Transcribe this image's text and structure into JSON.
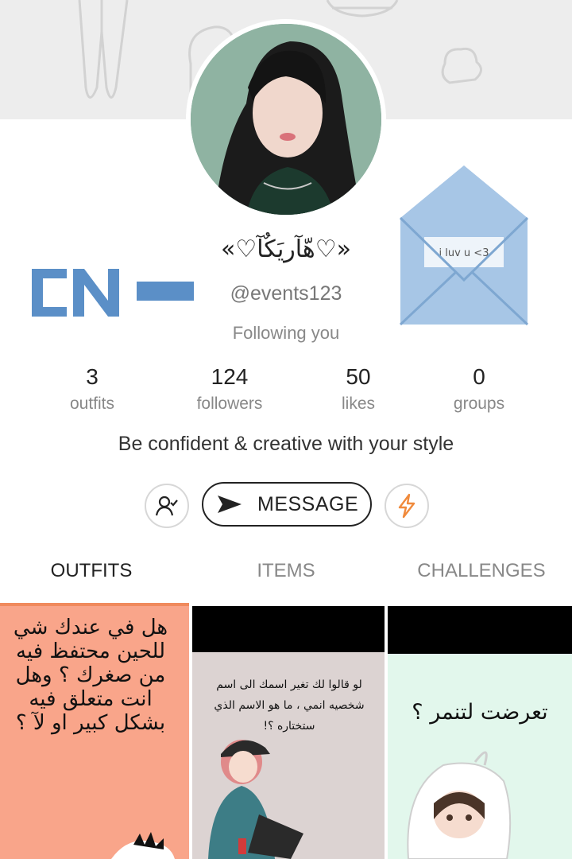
{
  "profile": {
    "display_name": "«♡هّآريَكٌآ♡»",
    "handle": "@events123",
    "follow_status": "Following you",
    "bio": "Be confident & creative with your style"
  },
  "stats": [
    {
      "value": "3",
      "label": "outfits"
    },
    {
      "value": "124",
      "label": "followers"
    },
    {
      "value": "50",
      "label": "likes"
    },
    {
      "value": "0",
      "label": "groups"
    }
  ],
  "actions": {
    "message_label": "MESSAGE",
    "follow_icon": "user-check-icon",
    "boost_icon": "lightning-icon"
  },
  "tabs": [
    {
      "label": "OUTFITS",
      "active": true
    },
    {
      "label": "ITEMS",
      "active": false
    },
    {
      "label": "CHALLENGES",
      "active": false
    }
  ],
  "stickers": {
    "left_text": "CN",
    "envelope_text": "i luv u <3"
  },
  "grid": [
    {
      "text": "هل في عندك شي للحين محتفظ فيه من صغرك ؟ وهل انت متعلق فيه بشكل كبير او لآ ؟"
    },
    {
      "text": "لو قالوا لك تغير اسمك الى اسم شخصيه انمي ، ما هو الاسم الذي ستختاره ؟!"
    },
    {
      "text": "تعرضت لتنمر ؟"
    }
  ],
  "colors": {
    "accent": "#f08a5d",
    "boost": "#f08a3c",
    "cn_blue": "#5b8fc7",
    "cover_bg": "#ededed"
  }
}
